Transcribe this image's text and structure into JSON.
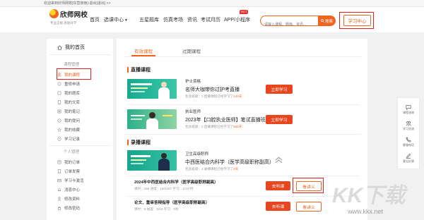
{
  "topbar": {
    "welcome": "欢迎来到欣师网校[东营夜雨]-退出[退出] >>"
  },
  "logo": {
    "name": "欣师网校",
    "slogan": "专业正规 高效升学"
  },
  "nav": {
    "items": [
      "首页",
      "选课中心",
      "五星题库",
      "仿真考场",
      "资讯",
      "考试月历",
      "APP/小程序"
    ],
    "hot_badge": "HOT"
  },
  "search": {
    "placeholder": "请输入课程、题库、资讯...",
    "button": "搜索"
  },
  "study_center": "学习中心",
  "sidebar": {
    "home": "我的首页",
    "course_section": "课程管理",
    "course_items": [
      "我的课程",
      "重修申请",
      "我的题库",
      "我的文库",
      "我的笔记",
      "我的提问",
      "我的收藏",
      "学习记录"
    ],
    "personal_section": "个人管理",
    "personal_items": [
      "我的订单",
      "订单发票",
      "学习卡激活",
      "消息中心",
      "修改资料",
      "修改密码"
    ]
  },
  "main": {
    "tabs": [
      {
        "label": "有效课程",
        "active": true
      },
      {
        "label": "过期课程",
        "active": false
      }
    ],
    "live_section": "直播课程",
    "live_courses": [
      {
        "category": "护士资格",
        "title": "名师大咖带你过护考直播",
        "meta": "包含班级：1   直播课程已经学习了",
        "days": "144天",
        "button": "立即学习"
      },
      {
        "category": "执业医师",
        "title": "2023年【口腔执业医师】笔试直播班套餐",
        "meta": "包含班级：2   直播课程已经学习了",
        "days": "502天",
        "button": "立即学习"
      }
    ],
    "recorded_section": "录播课程",
    "recorded_course": {
      "category": "卫生高级职称",
      "title": "中西医结合内科学（医学高级职称副高）",
      "meta": "包含班级：1   录播课程已经学习了",
      "days": "3天"
    },
    "lessons": [
      {
        "title": "2024年中西医结合内科学（医学高级职称副高）",
        "meta": "课时：256   进度：19/2157   学习：1/3小时",
        "listen": "去听课",
        "notes": "看讲义"
      },
      {
        "title": "论文、重审答辩指导（医学高级职称副高）",
        "meta": "课时：9   进度：5/34   学习：0秒",
        "listen": "去听课",
        "notes": "看讲义"
      }
    ]
  },
  "float_toolbar": {
    "items": [
      {
        "label": "课程咨询",
        "icon": "chat-icon"
      },
      {
        "label": "学习交流",
        "icon": "group-icon"
      },
      {
        "label": "客服电话",
        "icon": "phone-icon"
      },
      {
        "label": "意见反馈",
        "icon": "edit-icon"
      }
    ]
  },
  "watermark": {
    "brand": "KK下载",
    "url": "www.kkx.net"
  },
  "colors": {
    "accent": "#f0641e",
    "button_red": "#e8461e",
    "highlight_box": "#e02020",
    "thumb_teal": "#1bb39c"
  }
}
